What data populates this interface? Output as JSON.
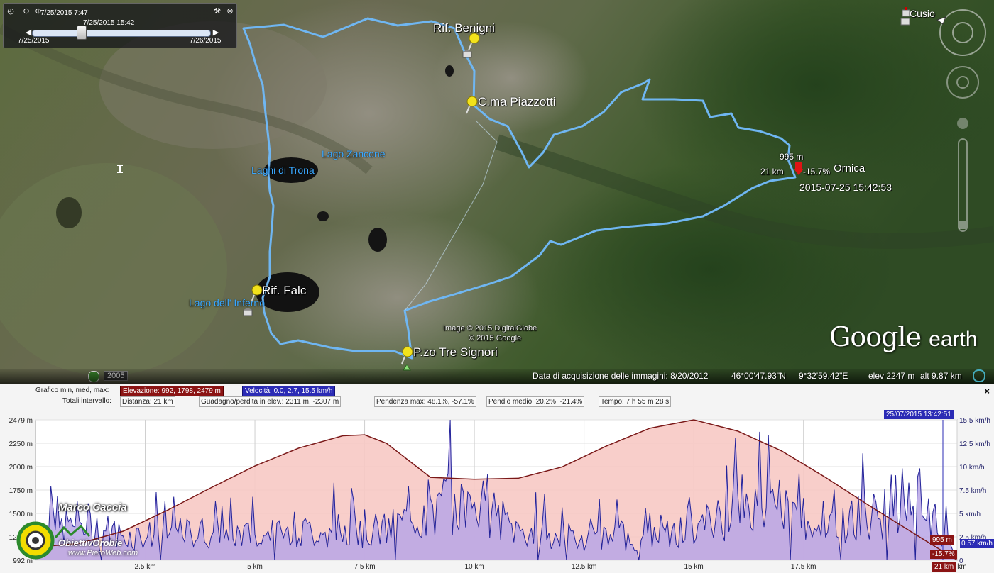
{
  "map": {
    "places": {
      "rif_benigni": "Rif. Benigni",
      "cma_piazzotti": "C.ma Piazzotti",
      "ornica": "Ornica",
      "rif_falc": "Rif. Falc",
      "pzo_tre_signori": "P.zo Tre Signori",
      "cusio": "Cusio"
    },
    "lakes": {
      "lago_zancone": "Lago Zancone",
      "laghi_di_trona": "Laghi di Trona",
      "lago_inferno": "Lago dell' Inferno"
    },
    "cursor": {
      "elevation": "995 m",
      "distance": "21 km",
      "slope": "-15.7%",
      "timestamp": "2015-07-25 15:42:53"
    },
    "credits": {
      "line1": "Image © 2015 DigitalGlobe",
      "line2": "© 2015 Google"
    },
    "logo": "Google",
    "logo_suffix": "earth",
    "historical_year": "2005"
  },
  "time_slider": {
    "current": "7/25/2015   7:47",
    "thumb_time": "7/25/2015  15:42",
    "start": "7/25/2015",
    "end": "7/26/2015"
  },
  "status_bar": {
    "acquisition": "Data di acquisizione delle immagini: 8/20/2012",
    "lat": "46°00'47.93\"N",
    "lon": "9°32'59.42\"E",
    "elev": "elev  2247 m",
    "alt": "alt   9.87 km"
  },
  "profile": {
    "graph_label": "Grafico  min, med, max:",
    "elevation_stats": "Elevazione: 992, 1798, 2479 m",
    "velocity_stats": "Velocità: 0.0, 2.7, 15.5 km/h",
    "totals_label": "Totali intervallo:",
    "distance": "Distanza: 21 km",
    "gain_loss": "Guadagno/perdita in elev.: 2311 m, -2307 m",
    "max_slope": "Pendenza max: 48.1%, -57.1%",
    "avg_slope": "Pendio medio: 20.2%, -21.4%",
    "time": "Tempo: 7 h 55 m 28 s",
    "cursor_time": "25/07/2015 13:42:51",
    "cursor_elev": "995 m",
    "cursor_slope": "-15.7%",
    "cursor_speed": "0.57 km/h",
    "cursor_dist": "21 km",
    "close": "×"
  },
  "watermark": {
    "author": "Marco Caccia",
    "brand": "ObiettivOrobie",
    "site": "www.PieroWeb.com"
  },
  "colors": {
    "track": "#6fb6f2",
    "elevation_fill": "#f7c9c4",
    "elevation_line": "#7a1818",
    "speed_fill": "#b8a6e6",
    "speed_line": "#222299"
  },
  "chart_data": {
    "type": "area",
    "x_unit": "km",
    "x_ticks": [
      "2.5 km",
      "5 km",
      "7.5 km",
      "10 km",
      "12.5 km",
      "15 km",
      "17.5 km",
      "21 km"
    ],
    "y_left_ticks": [
      "2479 m",
      "2250 m",
      "2000 m",
      "1750 m",
      "1500 m",
      "1250 m",
      "992 m"
    ],
    "y_right_ticks": [
      "15.5 km/h",
      "12.5 km/h",
      "10 km/h",
      "7.5 km/h",
      "5 km/h",
      "2.5 km/h",
      "0"
    ],
    "x_range": [
      0,
      21
    ],
    "y_left_range": [
      992,
      2479
    ],
    "y_right_range": [
      0,
      15.5
    ],
    "series": [
      {
        "name": "Elevazione",
        "x": [
          0,
          1,
          2,
          3,
          4,
          5,
          6,
          7,
          7.5,
          8,
          9,
          10,
          11,
          12,
          13,
          14,
          15,
          16,
          17,
          18,
          19,
          20,
          21
        ],
        "values": [
          1130,
          1170,
          1300,
          1520,
          1760,
          1990,
          2180,
          2310,
          2320,
          2230,
          1870,
          1850,
          1860,
          1980,
          2200,
          2390,
          2479,
          2360,
          2150,
          1870,
          1570,
          1280,
          995
        ]
      },
      {
        "name": "Velocità",
        "x": [
          0,
          1,
          2,
          3,
          4,
          5,
          6,
          7,
          8,
          9,
          10,
          11,
          12,
          13,
          14,
          15,
          16,
          17,
          18,
          19,
          20,
          21
        ],
        "values": [
          2.5,
          4.8,
          3.0,
          3.2,
          3.5,
          3.0,
          3.4,
          3.8,
          3.6,
          6.5,
          7.0,
          3.6,
          3.0,
          2.8,
          3.0,
          3.6,
          6.6,
          6.5,
          4.5,
          5.5,
          8.2,
          0.57
        ]
      }
    ]
  }
}
